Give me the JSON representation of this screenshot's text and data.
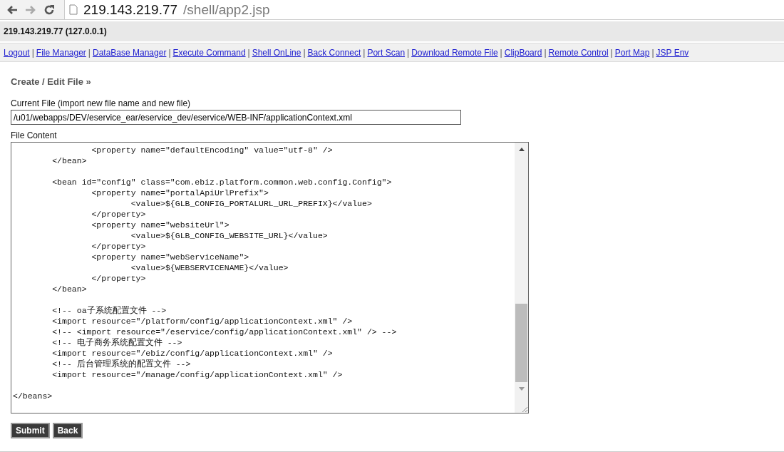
{
  "browser": {
    "url_host": "219.143.219.77",
    "url_path": "/shell/app2.jsp"
  },
  "header": {
    "title": "219.143.219.77 (127.0.0.1)"
  },
  "nav": {
    "separator": "|",
    "links": [
      "Logout",
      "File Manager",
      "DataBase Manager",
      "Execute Command",
      "Shell OnLine",
      "Back Connect",
      "Port Scan",
      "Download Remote File",
      "ClipBoard",
      "Remote Control",
      "Port Map",
      "JSP Env"
    ]
  },
  "form": {
    "heading": "Create / Edit File »",
    "current_file_label": "Current File (import new file name and new file)",
    "current_file_value": "/u01/webapps/DEV/eservice_ear/eservice_dev/eservice/WEB-INF/applicationContext.xml",
    "content_label": "File Content",
    "content": "\t\t<property name=\"defaultEncoding\" value=\"utf-8\" />\n\t</bean>\n\n\t<bean id=\"config\" class=\"com.ebiz.platform.common.web.config.Config\">\n\t\t<property name=\"portalApiUrlPrefix\">\n\t\t\t<value>${GLB_CONFIG_PORTALURL_URL_PREFIX}</value>\n\t\t</property>\n\t\t<property name=\"websiteUrl\">\n\t\t\t<value>${GLB_CONFIG_WEBSITE_URL}</value>\n\t\t</property>\n\t\t<property name=\"webServiceName\">\n\t\t\t<value>${WEBSERVICENAME}</value>\n\t\t</property>\n\t</bean>\n\n\t<!-- oa子系统配置文件 -->\n\t<import resource=\"/platform/config/applicationContext.xml\" />\n\t<!-- <import resource=\"/eservice/config/applicationContext.xml\" /> -->\n\t<!-- 电子商务系统配置文件 -->\n\t<import resource=\"/ebiz/config/applicationContext.xml\" />\n\t<!-- 后台管理系统的配置文件 -->\n\t<import resource=\"/manage/config/applicationContext.xml\" />\n\n</beans>",
    "buttons": [
      "Submit",
      "Back"
    ]
  }
}
